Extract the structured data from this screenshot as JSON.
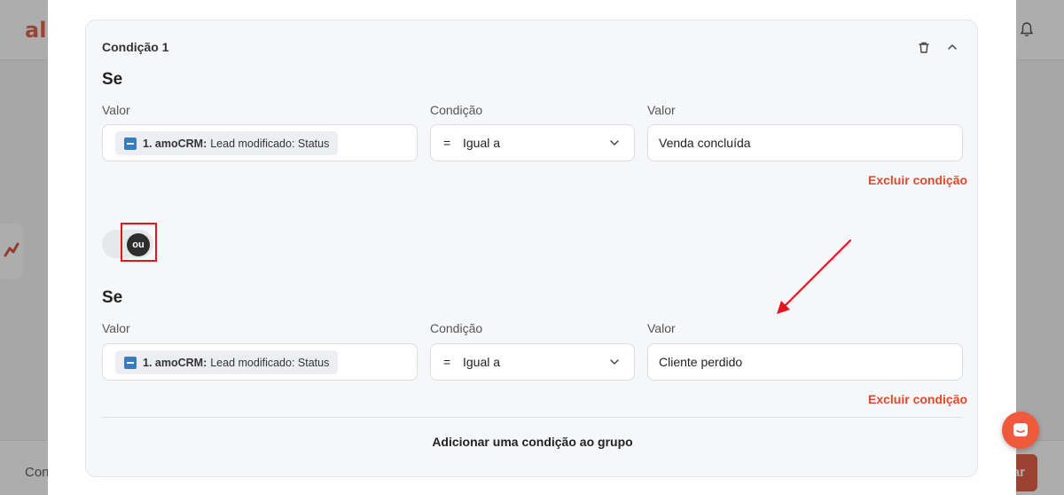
{
  "background": {
    "logo_text": "all",
    "footer_text": "Con",
    "footer_button": "ar"
  },
  "panel": {
    "title": "Condição 1"
  },
  "conditions": [
    {
      "heading": "Se",
      "value_label": "Valor",
      "condition_label": "Condição",
      "target_label": "Valor",
      "chip_app": "1. amoCRM:",
      "chip_field": "Lead modificado: Status",
      "operator_symbol": "=",
      "operator_text": "Igual a",
      "target_value": "Venda concluída",
      "delete_label": "Excluir condição"
    },
    {
      "heading": "Se",
      "value_label": "Valor",
      "condition_label": "Condição",
      "target_label": "Valor",
      "chip_app": "1. amoCRM:",
      "chip_field": "Lead modificado: Status",
      "operator_symbol": "=",
      "operator_text": "Igual a",
      "target_value": "Cliente perdido",
      "delete_label": "Excluir condição"
    }
  ],
  "toggle": {
    "label": "ou"
  },
  "add_condition_label": "Adicionar uma condição ao grupo",
  "colors": {
    "accent": "#e0492c",
    "highlight": "#e4161b",
    "knob": "#2d2d2d"
  }
}
